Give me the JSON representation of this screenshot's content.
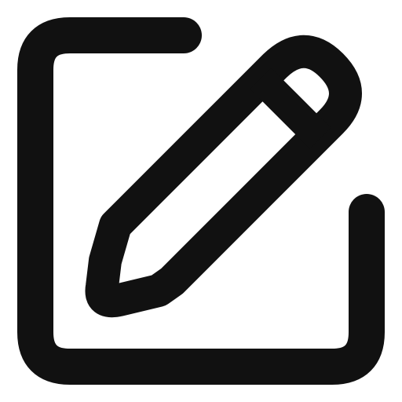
{
  "icon": {
    "name": "edit-icon",
    "stroke_color": "#111111",
    "background_color": "#ffffff"
  }
}
